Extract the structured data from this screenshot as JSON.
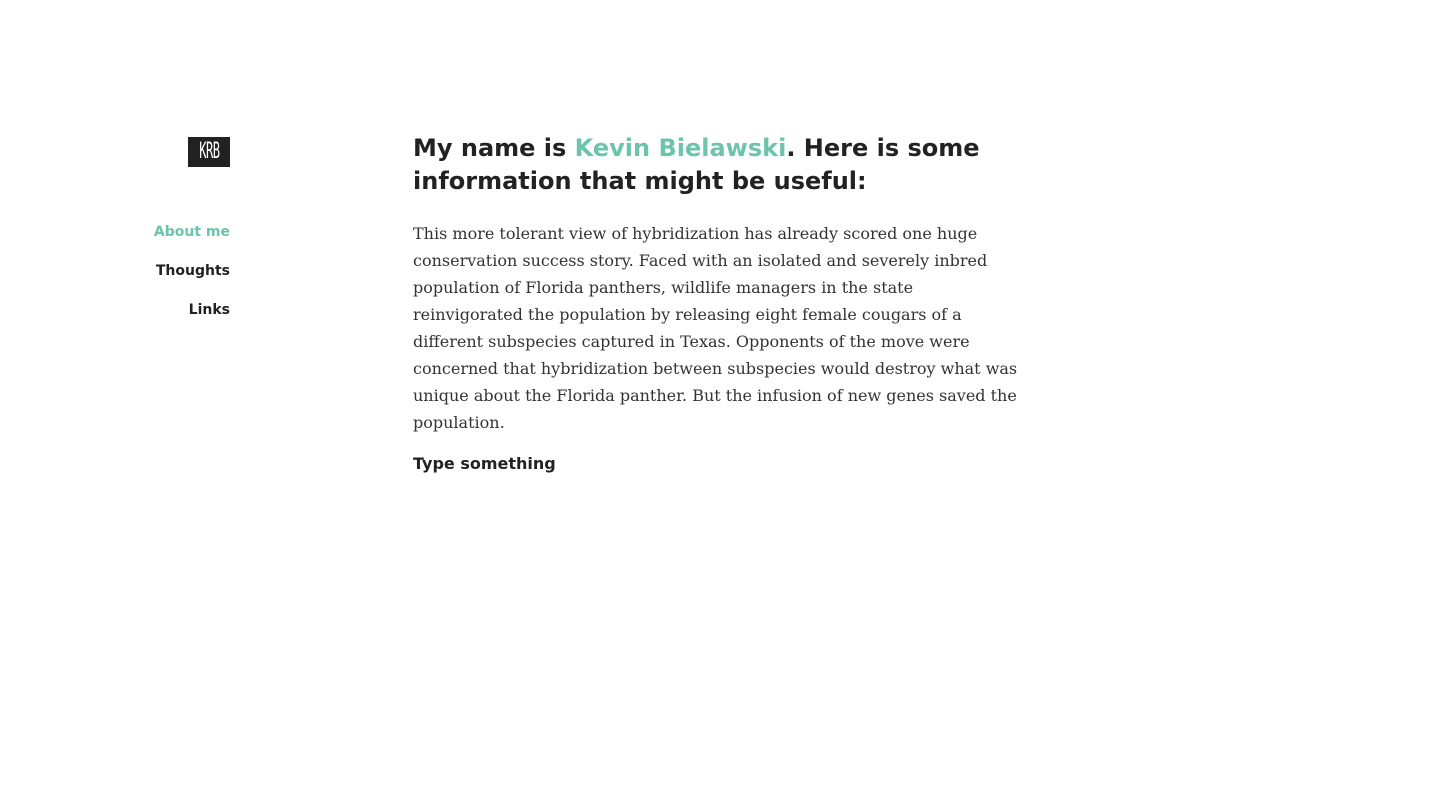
{
  "logo": {
    "text": "KRB"
  },
  "nav": {
    "items": [
      {
        "label": "About me",
        "active": true
      },
      {
        "label": "Thoughts",
        "active": false
      },
      {
        "label": "Links",
        "active": false
      }
    ]
  },
  "headline": {
    "prefix": "My name is ",
    "name": "Kevin Bielawski",
    "suffix": ". Here is some information that might be useful:"
  },
  "bio": {
    "text": "This more tolerant view of hybridization has already scored one huge conservation success story. Faced with an isolated and severely inbred population of Florida panthers, wildlife managers in the state reinvigorated the population by releasing eight female cougars of a different subspecies captured in Texas. Opponents of the move were concerned that hybridization between subspecies would destroy what was unique about the Florida panther. But the infusion of new genes saved the population."
  },
  "input": {
    "placeholder": "Type something",
    "value": ""
  },
  "colors": {
    "accent": "#6cc4ad",
    "text": "#222222",
    "background": "#ffffff"
  }
}
